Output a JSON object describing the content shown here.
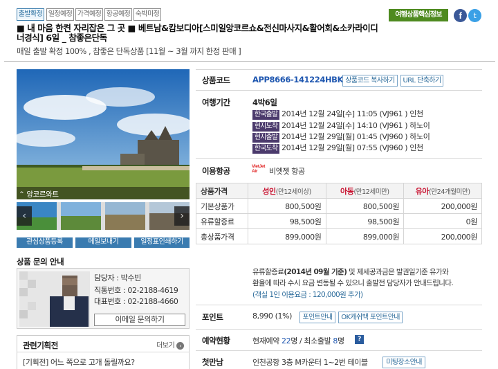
{
  "tags": [
    "출발확정",
    "일정예정",
    "가격예정",
    "항공예정",
    "숙박미정"
  ],
  "top_right": {
    "info_button": "여행상품핵심정보"
  },
  "title": {
    "line1": "■ 내 마음 한켠 자리잡은 그 곳 ■ 베트남&캄보디아[스미일앙코르쇼&전신마사지&활어회&소카라이디",
    "line2": "너경식] 6일 _ 참좋은단독",
    "subtitle": "매일 출발 확정 100% , 참좋은 단독상품 [11월 ~ 3월 까지 한정 판매 ]"
  },
  "gallery": {
    "caption": "앙코르와트",
    "buttons": [
      "관심상품등록",
      "메일보내기",
      "일정표인쇄하기"
    ]
  },
  "contact": {
    "title": "상품 문의 안내",
    "manager_label": "담당자 : 박수빈",
    "direct_label": "직통번호 : ",
    "direct_number": "02-2188-4619",
    "main_label": "대표번호 : ",
    "main_number": "02-2188-4660",
    "email_button": "이메일 문의하기"
  },
  "related": {
    "title": "관련기획전",
    "more": "더보기",
    "item": "[기획전] 어느 쪽으로 고개 돌릴까요?"
  },
  "product_code": {
    "label": "상품코드",
    "value": "APP8666-141224HBK",
    "copy_button": "상품코드 복사하기",
    "url_button": "URL 단축하기"
  },
  "period": {
    "label": "여행기간",
    "duration": "4박6일",
    "rows": [
      {
        "badge": "한국출발",
        "text": "2014년 12월 24일[수] 11:05 (VJ961 ) 인천"
      },
      {
        "badge": "현지도착",
        "text": "2014년 12월 24일[수] 14:10 (VJ961 ) 하노이"
      },
      {
        "badge": "현지출발",
        "text": "2014년 12월 29일[월] 01:45 (VJ960 ) 하노이"
      },
      {
        "badge": "한국도착",
        "text": "2014년 12월 29일[월] 07:55 (VJ960 ) 인천"
      }
    ]
  },
  "airline": {
    "label": "이용항공",
    "logo_text": "VietJet Air",
    "name": "비엣젯 항공"
  },
  "price_table": {
    "header": [
      "상품가격",
      "성인",
      "(만12세이상)",
      "아동",
      "(만12세미만)",
      "유아",
      "(만24개월미만)"
    ],
    "rows": [
      {
        "name": "기본상품가",
        "adult": "800,500원",
        "child": "800,500원",
        "infant": "200,000원"
      },
      {
        "name": "유류할증료",
        "adult": "98,500원",
        "child": "98,500원",
        "infant": "0원"
      },
      {
        "name": "총상품가격",
        "adult": "899,000원",
        "child": "899,000원",
        "infant": "200,000원"
      }
    ]
  },
  "price_note": {
    "prefix": "유류할증료",
    "bold": "(2014년 09월 기준)",
    "line1_rest": " 및 제세공과금은 발권일기준 유가와",
    "line2": "환율에 따라 수시 요금 변동될 수 있으니 출발전 담당자가 안내드립니다.",
    "line3": "(객실 1인 이용요금 : 120,000원 추가)"
  },
  "points": {
    "label": "포인트",
    "value": "8,990 (1%)",
    "btn1": "포인트안내",
    "btn2": "OK캐쉬백 포인트안내"
  },
  "reservation": {
    "label": "예약현황",
    "prefix": "현재예약 ",
    "current": "22",
    "middle": "명 / 최소출발 ",
    "minimum": "8",
    "suffix": "명"
  },
  "meeting": {
    "label": "첫만남",
    "value": "인천공항 3층 M카운터 1~2번 테이블",
    "button": "미팅장소안내"
  },
  "colors": {
    "accent_blue": "#1f57b0",
    "price_red": "#c8102e",
    "badge_purple": "#4b3a6c",
    "info_green": "#4e8a1f"
  }
}
